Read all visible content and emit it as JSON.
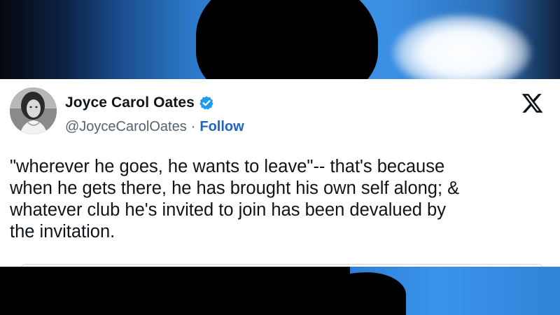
{
  "tweet": {
    "author": {
      "name": "Joyce Carol Oates",
      "handle": "@JoyceCarolOates",
      "verified": true,
      "avatar_icon": "avatar-photo"
    },
    "separator": "·",
    "follow_label": "Follow",
    "platform_icon": "x-logo-icon",
    "text": "\"wherever he goes, he wants to leave\"-- that's because\nwhen he gets there, he has brought his own self along; &\nwhatever club he's invited to join has been devalued by\nthe invitation."
  },
  "colors": {
    "text_primary": "#0f1419",
    "text_secondary": "#536471",
    "follow_link": "#1d64c9",
    "verified_badge": "#1d9bf0",
    "card_background": "#ffffff",
    "backdrop_blue": "#3b8fe4"
  }
}
